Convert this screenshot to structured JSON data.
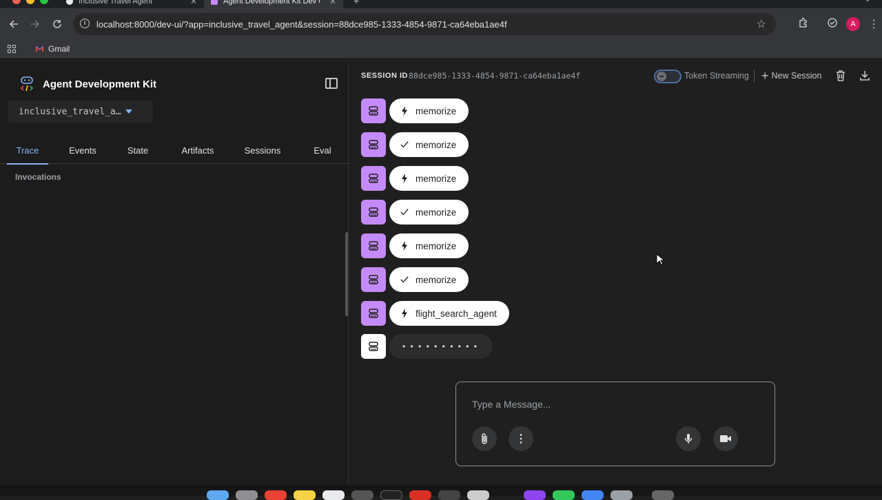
{
  "browser": {
    "tabs": [
      {
        "title": "Inclusive Travel Agent",
        "active": false
      },
      {
        "title": "Agent Development Kit Dev U",
        "active": true
      }
    ],
    "url": "localhost:8000/dev-ui/?app=inclusive_travel_agent&session=88dce985-1333-4854-9871-ca64eba1ae4f",
    "profile_initial": "A",
    "bookmarks": [
      {
        "label": "Gmail"
      }
    ]
  },
  "sidebar": {
    "brand": "Agent Development Kit",
    "app_selector": "inclusive_travel_a…",
    "tabs": [
      "Trace",
      "Events",
      "State",
      "Artifacts",
      "Sessions",
      "Eval"
    ],
    "active_tab": "Trace",
    "section_title": "Invocations"
  },
  "header": {
    "session_label": "SESSION ID",
    "session_id": "88dce985-1333-4854-9871-ca64eba1ae4f",
    "token_streaming_label": "Token Streaming",
    "token_streaming_on": false,
    "new_session_label": "New Session"
  },
  "events": [
    {
      "kind": "call",
      "icon": "bolt-icon",
      "label": "memorize"
    },
    {
      "kind": "response",
      "icon": "check-icon",
      "label": "memorize"
    },
    {
      "kind": "call",
      "icon": "bolt-icon",
      "label": "memorize"
    },
    {
      "kind": "response",
      "icon": "check-icon",
      "label": "memorize"
    },
    {
      "kind": "call",
      "icon": "bolt-icon",
      "label": "memorize"
    },
    {
      "kind": "response",
      "icon": "check-icon",
      "label": "memorize"
    },
    {
      "kind": "call",
      "icon": "bolt-icon",
      "label": "flight_search_agent"
    }
  ],
  "loading_indicator": "• • • • • • • • • •",
  "composer": {
    "placeholder": "Type a Message..."
  },
  "colors": {
    "accent": "#8ab4f8",
    "bot_avatar": "#c58af9",
    "profile": "#d81b60"
  }
}
